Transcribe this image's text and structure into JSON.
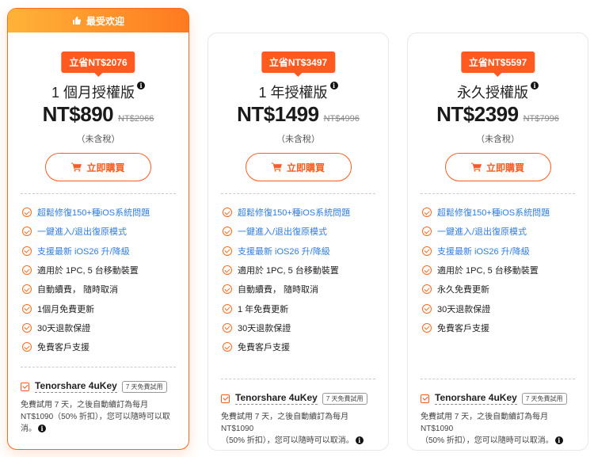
{
  "plans": [
    {
      "ribbon": "最受欢迎",
      "save": "立省NT$2076",
      "name": "1 個月授權版",
      "price": "NT$890",
      "old_price": "NT$2966",
      "tax": "（未含稅）",
      "buy": "立即購買",
      "features": [
        "超鬆修復150+種iOS系統問題",
        "一鍵進入/退出復原模式",
        "支援最新 iOS26 升/降級",
        "適用於 1PC, 5 台移動裝置",
        "自動續費， 隨時取消",
        "1個月免費更新",
        "30天退款保證",
        "免費客戶支援"
      ],
      "addon_name": "Tenorshare 4uKey",
      "addon_tag": "7 天免費試用",
      "addon_desc_1": "免費試用 7 天，之後自動續訂為每月",
      "addon_desc_2": "NT$1090（50% 折扣），您可以隨時可以取",
      "addon_desc_3": "消。"
    },
    {
      "save": "立省NT$3497",
      "name": "1 年授權版",
      "price": "NT$1499",
      "old_price": "NT$4996",
      "tax": "（未含稅）",
      "buy": "立即購買",
      "features": [
        "超鬆修復150+種iOS系統問題",
        "一鍵進入/退出復原模式",
        "支援最新 iOS26 升/降級",
        "適用於 1PC, 5 台移動裝置",
        "自動續費， 隨時取消",
        "1 年免費更新",
        "30天退款保證",
        "免費客戶支援"
      ],
      "addon_name": "Tenorshare 4uKey",
      "addon_tag": "7 天免費試用",
      "addon_desc_1": "免費試用 7 天，之後自動續訂為每月 NT$1090",
      "addon_desc_2": "（50% 折扣），您可以隨時可以取消。"
    },
    {
      "save": "立省NT$5597",
      "name": "永久授權版",
      "price": "NT$2399",
      "old_price": "NT$7996",
      "tax": "（未含稅）",
      "buy": "立即購買",
      "features": [
        "超鬆修復150+種iOS系統問題",
        "一鍵進入/退出復原模式",
        "支援最新 iOS26 升/降級",
        "適用於 1PC, 5 台移動裝置",
        "永久免費更新",
        "30天退款保證",
        "免費客戶支援"
      ],
      "addon_name": "Tenorshare 4uKey",
      "addon_tag": "7 天免費試用",
      "addon_desc_1": "免費試用 7 天，之後自動續訂為每月 NT$1090",
      "addon_desc_2": "（50% 折扣），您可以隨時可以取消。"
    }
  ],
  "colors": {
    "accent": "#ff5a1f",
    "link_blue": "#2f7de1",
    "ribbon_start": "#ffb338",
    "ribbon_end": "#ff7a1f"
  },
  "icons": {
    "ribbon": "thumbs-up-icon",
    "buy": "cart-icon",
    "info": "info-icon",
    "feature": "check-circle-icon",
    "addon": "checkbox-icon"
  }
}
